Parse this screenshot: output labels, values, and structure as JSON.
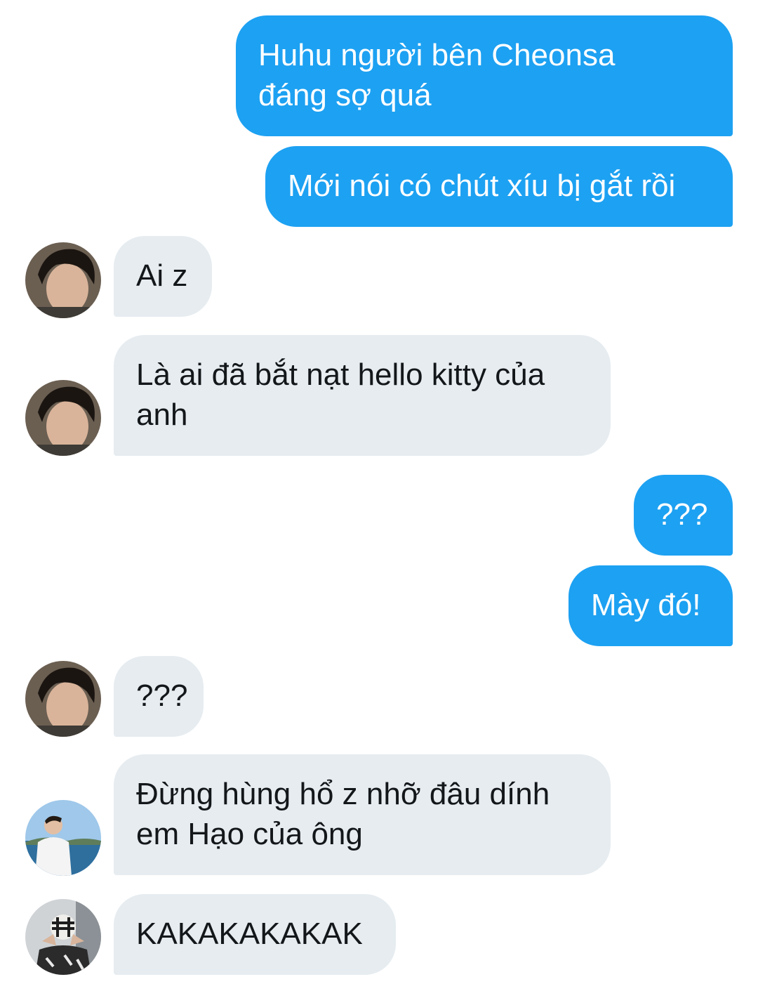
{
  "conversation": {
    "messages": [
      {
        "id": "m1",
        "direction": "sent",
        "text": "Huhu người bên Cheonsa\nđáng sợ quá"
      },
      {
        "id": "m2",
        "direction": "sent",
        "text": "Mới nói có chút xíu bị gắt rồi"
      },
      {
        "id": "m3",
        "direction": "received",
        "avatar": "avatar-a",
        "text": "Ai z"
      },
      {
        "id": "m4",
        "direction": "received",
        "avatar": "avatar-a",
        "text": "Là ai đã bắt nạt hello kitty của\nanh"
      },
      {
        "id": "m5",
        "direction": "sent",
        "text": "???"
      },
      {
        "id": "m6",
        "direction": "sent",
        "text": "Mày đó!"
      },
      {
        "id": "m7",
        "direction": "received",
        "avatar": "avatar-a",
        "text": "???"
      },
      {
        "id": "m8",
        "direction": "received",
        "avatar": "avatar-b",
        "text": "Đừng hùng hổ z nhỡ đâu dính\nem Hạo của ông"
      },
      {
        "id": "m9",
        "direction": "received",
        "avatar": "avatar-c",
        "text": "KAKAKAKAKAK"
      }
    ]
  },
  "colors": {
    "sent_bubble": "#1da1f2",
    "sent_text": "#ffffff",
    "received_bubble": "#e6ecf0",
    "received_text": "#14171a",
    "background": "#ffffff"
  }
}
